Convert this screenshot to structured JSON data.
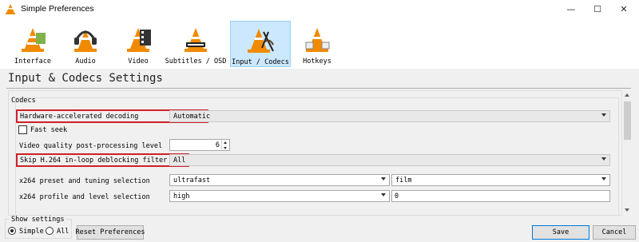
{
  "window": {
    "title": "Simple Preferences",
    "minimize_glyph": "—",
    "maximize_glyph": "☐",
    "close_glyph": "✕"
  },
  "categories": [
    {
      "label": "Interface",
      "icon": "vlc-cone-interface-icon",
      "selected": false
    },
    {
      "label": "Audio",
      "icon": "vlc-cone-headphones-icon",
      "selected": false
    },
    {
      "label": "Video",
      "icon": "vlc-cone-film-icon",
      "selected": false
    },
    {
      "label": "Subtitles / OSD",
      "icon": "vlc-cone-subtitles-icon",
      "selected": false
    },
    {
      "label": "Input / Codecs",
      "icon": "vlc-cone-codecs-icon",
      "selected": true
    },
    {
      "label": "Hotkeys",
      "icon": "vlc-cone-hotkeys-icon",
      "selected": false
    }
  ],
  "page_title": "Input & Codecs Settings",
  "codecs": {
    "group_title": "Codecs",
    "hw_decoding": {
      "label": "Hardware-accelerated decoding",
      "value": "Automatic"
    },
    "fast_seek": {
      "label": "Fast seek",
      "checked": false
    },
    "pp_level": {
      "label": "Video quality post-processing level",
      "value": "6"
    },
    "skip_h264": {
      "label": "Skip H.264 in-loop deblocking filter",
      "value": "All"
    },
    "x264_preset": {
      "label": "x264 preset and tuning selection",
      "preset": "ultrafast",
      "tuning": "film"
    },
    "x264_profile": {
      "label": "x264 profile and level selection",
      "profile": "high",
      "level": "0"
    }
  },
  "show_settings": {
    "title": "Show settings",
    "simple_label": "Simple",
    "all_label": "All",
    "selected": "Simple"
  },
  "buttons": {
    "reset": "Reset Preferences",
    "save": "Save",
    "cancel": "Cancel"
  },
  "colors": {
    "highlight": "#d0202a",
    "selected_tab": "#cce8ff",
    "cone_orange": "#f08a00"
  }
}
